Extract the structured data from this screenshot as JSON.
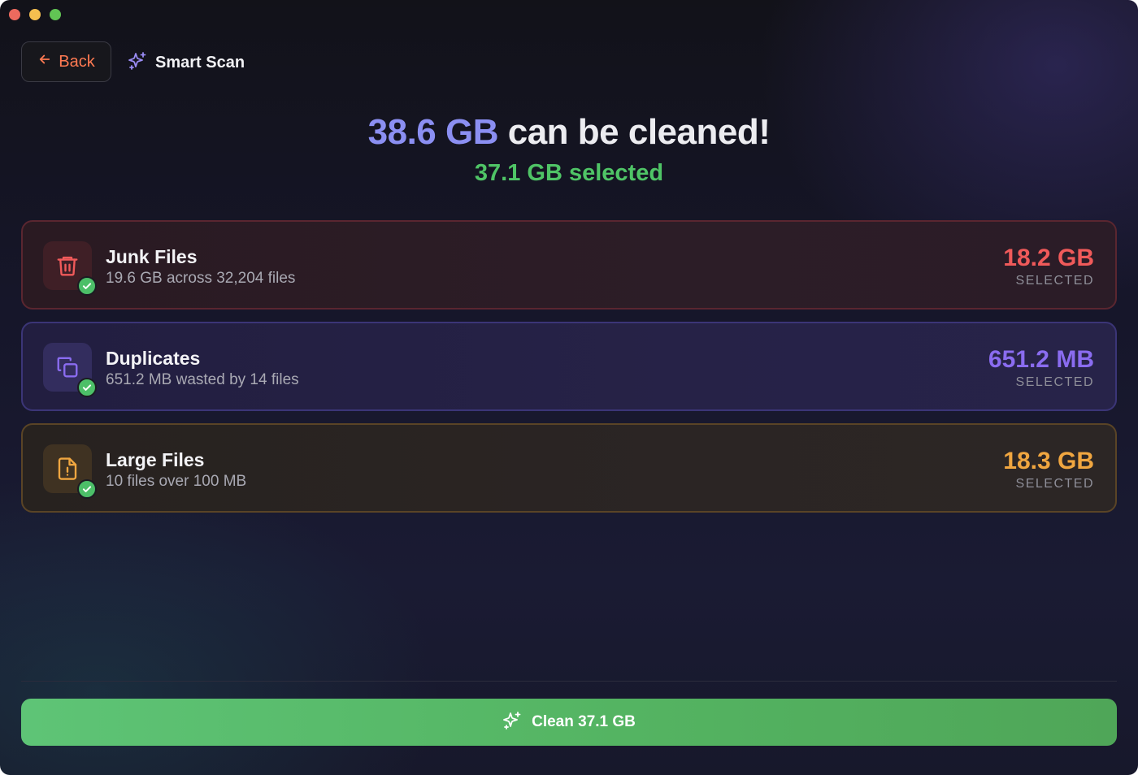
{
  "window": {
    "controls": [
      "close",
      "minimize",
      "maximize"
    ]
  },
  "header": {
    "back_label": "Back",
    "back_icon": "arrow-left-icon",
    "breadcrumb_icon": "sparkles-icon",
    "breadcrumb_label": "Smart Scan"
  },
  "summary": {
    "total_amount": "38.6 GB",
    "total_suffix": "can be cleaned!",
    "selected_text": "37.1 GB selected"
  },
  "categories": [
    {
      "title": "Junk Files",
      "subtitle": "19.6 GB across 32,204 files",
      "size": "18.2 GB",
      "status": "SELECTED",
      "icon": "trash-icon",
      "checked": true,
      "accent": "#f05a5a"
    },
    {
      "title": "Duplicates",
      "subtitle": "651.2 MB wasted by 14 files",
      "size": "651.2 MB",
      "status": "SELECTED",
      "icon": "copy-icon",
      "checked": true,
      "accent": "#8a6cf0"
    },
    {
      "title": "Large Files",
      "subtitle": "10 files over 100 MB",
      "size": "18.3 GB",
      "status": "SELECTED",
      "icon": "file-alert-icon",
      "checked": true,
      "accent": "#f0a640"
    }
  ],
  "action": {
    "clean_label": "Clean 37.1 GB",
    "clean_icon": "sparkles-icon",
    "color": "#5ec476"
  }
}
